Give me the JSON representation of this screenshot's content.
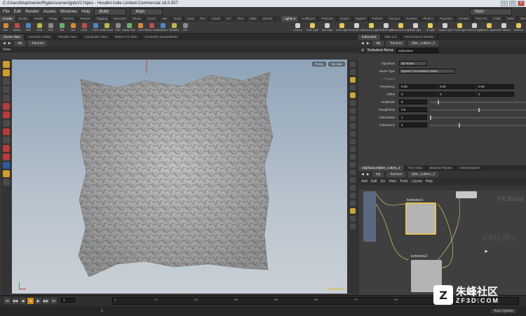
{
  "titlebar": {
    "text": "C:/Users/bluphoenix/Rigids/scene/rigidsV2.hipnc - Houdini Indie Limited-Commercial 16.0.557"
  },
  "menu": {
    "items": [
      "File",
      "Edit",
      "Render",
      "Assets",
      "Windows",
      "Help"
    ],
    "desktop": "Build",
    "main": "Main",
    "right_desktop": "Main"
  },
  "shelf_tabs_left": [
    "Create",
    "Modify",
    "Model",
    "Polyg",
    "Deform",
    "Texture",
    "Rigging",
    "MuscSet",
    "Chara",
    "Const",
    "Hair",
    "Guid",
    "Guid",
    "Terr",
    "Cloud",
    "Vol",
    "Shel",
    "Cliks",
    "Simula"
  ],
  "shelf_tabs_right": [
    "Lights a",
    "Collisions",
    "Particles",
    "Grains",
    "Rigid B",
    "Particle",
    "Viscous",
    "Oceans",
    "Fluid C",
    "Populate",
    "Contain",
    "Pyro FX",
    "Cloth",
    "Solid",
    "Wires",
    "Crowds",
    "Drive Si"
  ],
  "shelf_tools_left": [
    "Box",
    "Sphere",
    "Tube",
    "Torus",
    "Grid",
    "Null",
    "Line",
    "Circle",
    "Curve",
    "Draw Curve",
    "Path",
    "Spray Paint",
    "Font",
    "Platonic Solids",
    "L-System",
    "Metaball",
    "File"
  ],
  "shelf_tools_right": [
    "Camera",
    "Point Light",
    "Spot Light",
    "Area Light",
    "Geometry Light",
    "Volume Light",
    "Distant Light",
    "Environment Light",
    "Sky Light",
    "GI Light",
    "Caustic Light",
    "Portal Light",
    "Ambient Light",
    "Stereo Camera",
    "VR Camera",
    "Switcher"
  ],
  "left_tabs": [
    "Scene View",
    "Animation Editor",
    "Render View",
    "Composite View",
    "Motion FX View",
    "Geometry Spreadsheet"
  ],
  "left_path": {
    "obj": "obj",
    "node": "fracture"
  },
  "viewport": {
    "label": "View",
    "persp": "Persp",
    "cam": "No cam",
    "indie": "Indie Edition"
  },
  "right_top_tabs": [
    "turbnoise1",
    "Take List",
    "Performance Monitor"
  ],
  "right_top_path": {
    "obj": "obj",
    "node": "fracture",
    "sub": "jitter_cutters_2"
  },
  "params": {
    "header_type": "Turbulent Noise",
    "header_name": "turbnoise1",
    "signature_label": "Signature",
    "signature_value": "3D Noise",
    "noise_type_label": "Noise Type",
    "noise_type_value": "Sparse Convolution Noise",
    "position_label": "Position",
    "frequency_label": "Frequency",
    "frequency": [
      "0.05",
      "0.05",
      "0.05"
    ],
    "offset_label": "Offset",
    "offset": [
      "0",
      "0",
      "0"
    ],
    "amplitude_label": "Amplitude",
    "amplitude": "8",
    "roughness_label": "Roughness",
    "roughness": "0.5",
    "attenuation_label": "Attenuation",
    "attenuation": "1",
    "turbulence_label": "Turbulence",
    "turbulence": "3",
    "levels": {
      "amplitude": 0.08,
      "roughness": 0.5,
      "attenuation": 0.0,
      "turbulence": 0.3
    }
  },
  "right_bottom_tabs": [
    "/obj/fracture/jitter_cutters_2",
    "Tree View",
    "Material Palette",
    "Asset Browser"
  ],
  "net_menu": [
    "Add",
    "Edit",
    "Go",
    "View",
    "Tools",
    "Layout",
    "Help"
  ],
  "net": {
    "node1": "turbnoise1",
    "node2": "turbnoise2",
    "watermark": "CHOPs",
    "badge": "FX Build"
  },
  "timeline": {
    "frame": "1",
    "ticks": [
      "1",
      "12",
      "24",
      "36",
      "48",
      "60",
      "72",
      "84",
      "96",
      "108"
    ],
    "end": "1"
  },
  "status": {
    "right": "Auto Update"
  },
  "watermark": {
    "cn": "朱峰社区",
    "url": "ZF3D.COM"
  }
}
